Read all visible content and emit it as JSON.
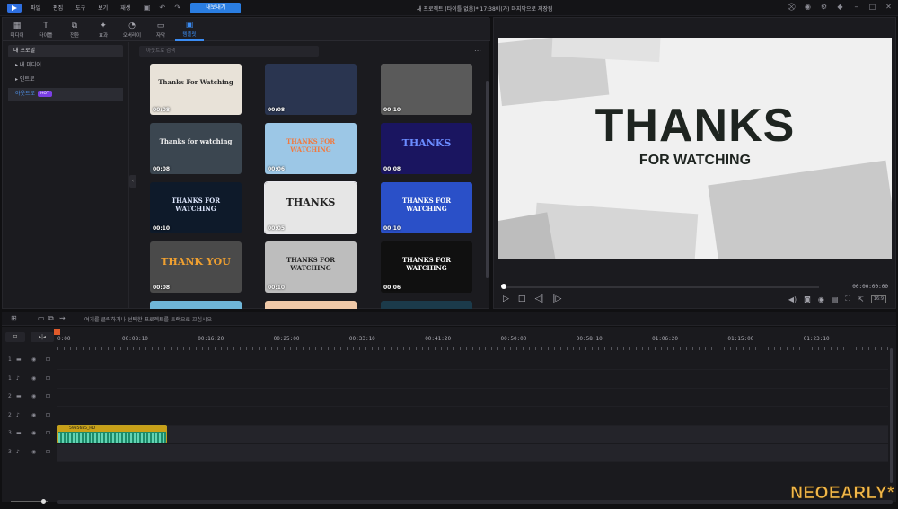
{
  "app": {
    "title": "새 프로젝트 (타이틀 없음)* 17:38이(가) 마지막으로 저장됨",
    "menu": [
      "파일",
      "편집",
      "도구",
      "보기",
      "재생"
    ],
    "export_label": "내보내기"
  },
  "tabs": [
    {
      "icon": "media-icon",
      "glyph": "▦",
      "label": "미디어"
    },
    {
      "icon": "title-icon",
      "glyph": "T",
      "label": "타이틀"
    },
    {
      "icon": "transition-icon",
      "glyph": "⧉",
      "label": "전환"
    },
    {
      "icon": "effect-icon",
      "glyph": "✦",
      "label": "효과"
    },
    {
      "icon": "overlay-icon",
      "glyph": "◔",
      "label": "오버레이"
    },
    {
      "icon": "subtitle-icon",
      "glyph": "▭",
      "label": "자막"
    },
    {
      "icon": "template-icon",
      "glyph": "▣",
      "label": "템플릿"
    }
  ],
  "sidebar": {
    "header": "내 프로필",
    "items": [
      {
        "label": "▸ 내 미디어"
      },
      {
        "label": "▸ 인트로"
      },
      {
        "label": "아웃트로",
        "badge": "HOT"
      }
    ]
  },
  "search": {
    "placeholder": "아웃트로 검색"
  },
  "templates": [
    {
      "duration": "00:08",
      "text": "Thanks For Watching",
      "bg": "#e8e2d8",
      "fg": "#2a2a2a"
    },
    {
      "duration": "00:08",
      "text": "",
      "bg": "#2a3550",
      "fg": "#fff"
    },
    {
      "duration": "00:10",
      "text": "",
      "bg": "#5a5a5a",
      "fg": "#fff"
    },
    {
      "duration": "00:08",
      "text": "Thanks for watching",
      "bg": "#3b4650",
      "fg": "#f0f0f0"
    },
    {
      "duration": "00:06",
      "text": "THANKS FOR WATCHING",
      "bg": "#9cc7e6",
      "fg": "#f07a40"
    },
    {
      "duration": "00:08",
      "text": "THANKS",
      "bg": "#1a1560",
      "fg": "#6b8cff"
    },
    {
      "duration": "00:10",
      "text": "THANKS FOR WATCHING",
      "bg": "#0e1a2a",
      "fg": "#dfe8ff"
    },
    {
      "duration": "00:05",
      "text": "THANKS",
      "bg": "#e6e6e6",
      "fg": "#222"
    },
    {
      "duration": "00:10",
      "text": "THANKS FOR WATCHING",
      "bg": "#2a50c8",
      "fg": "#fff"
    },
    {
      "duration": "00:08",
      "text": "THANK YOU",
      "bg": "#4a4a4a",
      "fg": "#f0a030"
    },
    {
      "duration": "00:10",
      "text": "THANKS FOR WATCHING",
      "bg": "#bdbdbd",
      "fg": "#222"
    },
    {
      "duration": "00:06",
      "text": "THANKS FOR WATCHING",
      "bg": "#101010",
      "fg": "#fff"
    }
  ],
  "preview": {
    "title_big": "THANKS",
    "title_small": "FOR WATCHING",
    "timecode": "00:00:00:00",
    "ratio": "16:9"
  },
  "timeline": {
    "hint": "여기를 클릭하거나 선택한 프로젝트를 트랙으로 끄십시오",
    "ruler": [
      "0:00",
      "00:08:10",
      "00:16:20",
      "00:25:00",
      "00:33:10",
      "00:41:20",
      "00:50:00",
      "00:58:10",
      "01:06:20",
      "01:15:00",
      "01:23:10"
    ],
    "tracks": [
      {
        "num": "1",
        "type": "video-icon",
        "glyph": "▬"
      },
      {
        "num": "1",
        "type": "audio-icon",
        "glyph": "♪"
      },
      {
        "num": "2",
        "type": "video-icon",
        "glyph": "▬"
      },
      {
        "num": "2",
        "type": "audio-icon",
        "glyph": "♪"
      },
      {
        "num": "3",
        "type": "video-icon",
        "glyph": "▬"
      },
      {
        "num": "3",
        "type": "audio-icon",
        "glyph": "♪"
      }
    ],
    "clip_label": "5985685_HD"
  },
  "watermark": "NEOEARLY*"
}
